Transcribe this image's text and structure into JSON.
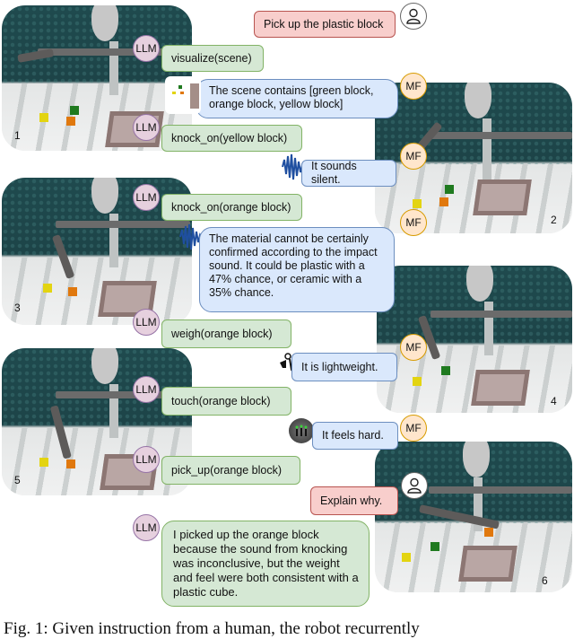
{
  "scenes": [
    {
      "label": "1"
    },
    {
      "label": "2"
    },
    {
      "label": "3"
    },
    {
      "label": "4"
    },
    {
      "label": "5"
    },
    {
      "label": "6"
    }
  ],
  "messages": {
    "human_instruction": "Pick up the plastic block",
    "llm_visualize": "visualize(scene)",
    "mf_scene": "The scene contains [green block, orange block, yellow block]",
    "llm_knock_yellow": "knock_on(yellow block)",
    "mf_silent": "It sounds silent.",
    "llm_knock_orange": "knock_on(orange block)",
    "mf_material": "The material cannot be certainly confirmed according to the impact sound. It could be plastic with a 47% chance, or ceramic with a 35% chance.",
    "llm_weigh": "weigh(orange block)",
    "mf_lightweight": "It is lightweight.",
    "llm_touch": "touch(orange block)",
    "mf_hard": "It feels hard.",
    "llm_pickup": "pick_up(orange block)",
    "human_explain": "Explain why.",
    "llm_explanation": "I picked up the orange block because the sound from knocking was inconclusive, but the weight and feel were both consistent with a plastic cube."
  },
  "avatars": {
    "llm": "LLM",
    "mf": "MF",
    "human_icon": "person-icon"
  },
  "caption": "Fig. 1: Given instruction from a human, the robot recurrently",
  "colors": {
    "llm_bubble": "#d5e8d4",
    "mf_bubble": "#dae8fc",
    "human_bubble": "#f8cecc",
    "llm_avatar": "#e6d0de",
    "mf_avatar": "#ffe6cc"
  }
}
